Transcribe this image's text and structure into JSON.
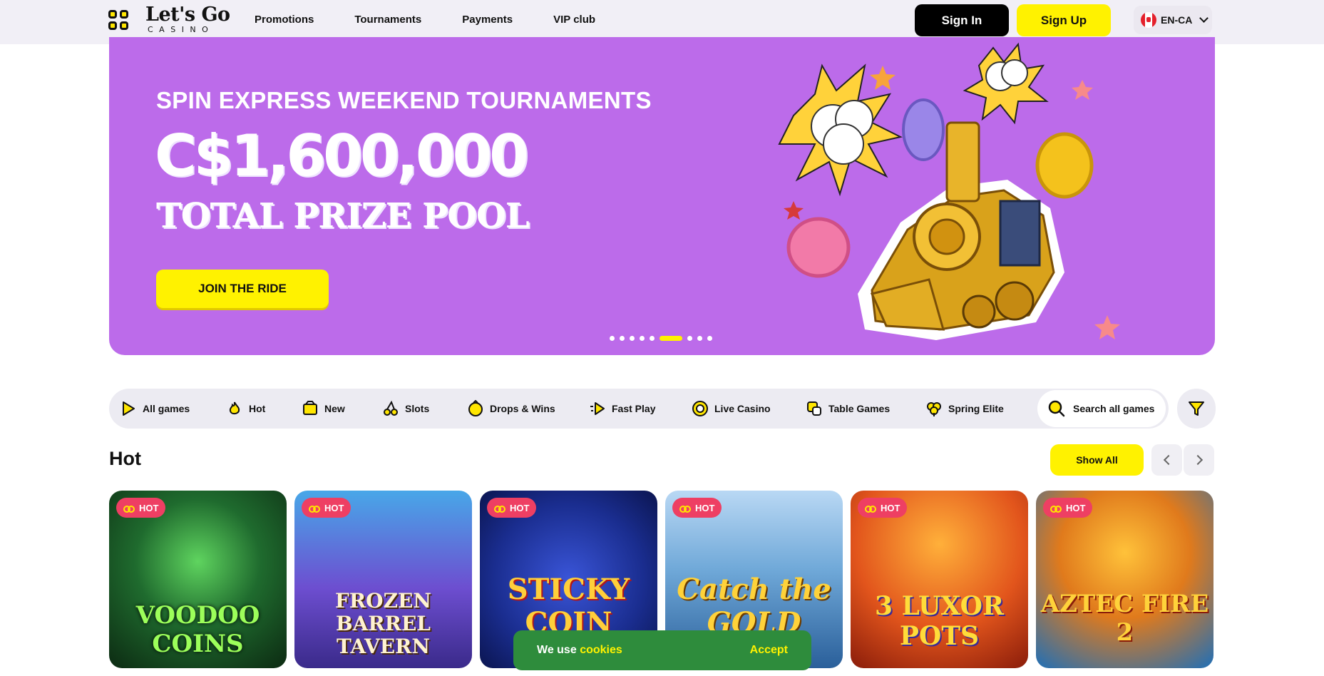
{
  "header": {
    "logo_main": "Let's Go",
    "logo_sub": "CASINO",
    "nav": [
      "Promotions",
      "Tournaments",
      "Payments",
      "VIP club"
    ],
    "sign_in": "Sign In",
    "sign_up": "Sign Up",
    "language": "EN-CA"
  },
  "banner": {
    "kicker": "SPIN EXPRESS WEEKEND TOURNAMENTS",
    "amount": "C$1,600,000",
    "subtitle": "TOTAL PRIZE POOL",
    "cta": "JOIN THE RIDE",
    "slide_count": 9,
    "active_slide": 6
  },
  "categories": [
    "All games",
    "Hot",
    "New",
    "Slots",
    "Drops & Wins",
    "Fast Play",
    "Live Casino",
    "Table Games",
    "Spring Elite"
  ],
  "search_label": "Search all games",
  "hot_section": {
    "title": "Hot",
    "show_all": "Show All",
    "badge": "HOT",
    "games": [
      {
        "title": "VOODOO COINS",
        "color": "#1f6b2e"
      },
      {
        "title": "FROZEN BARREL TAVERN",
        "color": "#5a3aa8"
      },
      {
        "title": "STICKY COIN",
        "color": "#1a2d8f"
      },
      {
        "title": "Catch the GOLD",
        "color": "#3a7fc4"
      },
      {
        "title": "3 LUXOR POTS",
        "color": "#d8421c"
      },
      {
        "title": "AZTEC FIRE 2",
        "color": "#1e6fb8"
      }
    ]
  },
  "cookie": {
    "text_prefix": "We use",
    "text_link": "cookies",
    "accept": "Accept"
  },
  "colors": {
    "accent_yellow": "#fff200",
    "banner_purple": "#bc6bea",
    "hot_badge": "#ee3f63",
    "cookie_green": "#2e8c3c"
  }
}
